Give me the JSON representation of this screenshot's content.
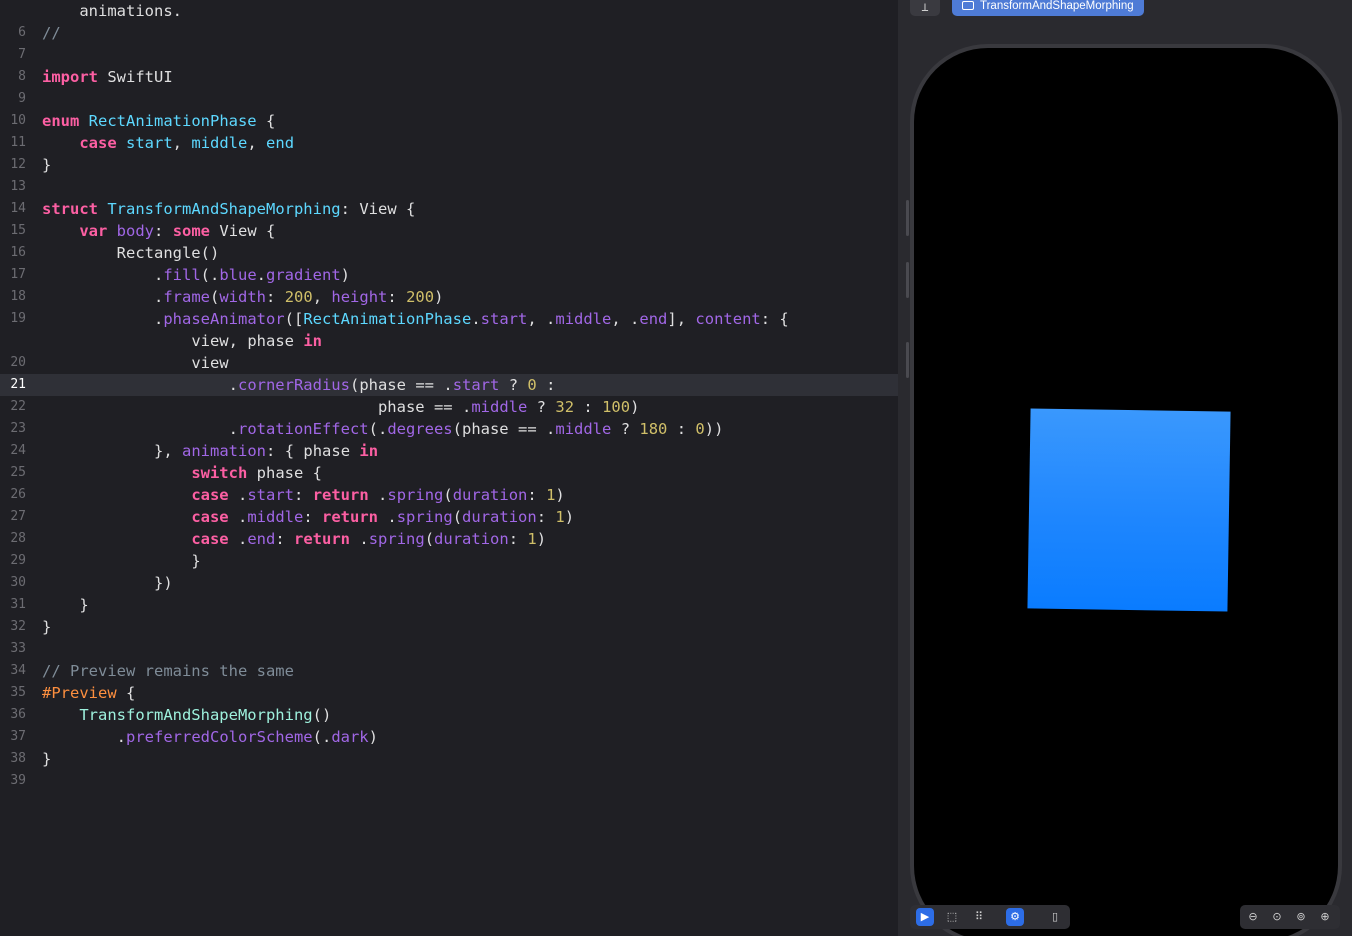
{
  "editor": {
    "current_line": "21",
    "lines": [
      {
        "n": "",
        "code": "    animations."
      },
      {
        "n": "6",
        "code": "//"
      },
      {
        "n": "7",
        "code": ""
      },
      {
        "n": "8",
        "code": "import SwiftUI"
      },
      {
        "n": "9",
        "code": ""
      },
      {
        "n": "10",
        "code": "enum RectAnimationPhase {"
      },
      {
        "n": "11",
        "code": "    case start, middle, end"
      },
      {
        "n": "12",
        "code": "}"
      },
      {
        "n": "13",
        "code": ""
      },
      {
        "n": "14",
        "code": "struct TransformAndShapeMorphing: View {"
      },
      {
        "n": "15",
        "code": "    var body: some View {"
      },
      {
        "n": "16",
        "code": "        Rectangle()"
      },
      {
        "n": "17",
        "code": "            .fill(.blue.gradient)"
      },
      {
        "n": "18",
        "code": "            .frame(width: 200, height: 200)"
      },
      {
        "n": "19",
        "code": "            .phaseAnimator([RectAnimationPhase.start, .middle, .end], content: {"
      },
      {
        "n": "",
        "code": "                view, phase in"
      },
      {
        "n": "20",
        "code": "                view"
      },
      {
        "n": "21",
        "code": "                    .cornerRadius(phase == .start ? 0 :"
      },
      {
        "n": "22",
        "code": "                                    phase == .middle ? 32 : 100)"
      },
      {
        "n": "23",
        "code": "                    .rotationEffect(.degrees(phase == .middle ? 180 : 0))"
      },
      {
        "n": "24",
        "code": "            }, animation: { phase in"
      },
      {
        "n": "25",
        "code": "                switch phase {"
      },
      {
        "n": "26",
        "code": "                case .start: return .spring(duration: 1)"
      },
      {
        "n": "27",
        "code": "                case .middle: return .spring(duration: 1)"
      },
      {
        "n": "28",
        "code": "                case .end: return .spring(duration: 1)"
      },
      {
        "n": "29",
        "code": "                }"
      },
      {
        "n": "30",
        "code": "            })"
      },
      {
        "n": "31",
        "code": "    }"
      },
      {
        "n": "32",
        "code": "}"
      },
      {
        "n": "33",
        "code": ""
      },
      {
        "n": "34",
        "code": "// Preview remains the same"
      },
      {
        "n": "35",
        "code": "#Preview {"
      },
      {
        "n": "36",
        "code": "    TransformAndShapeMorphing()"
      },
      {
        "n": "37",
        "code": "        .preferredColorScheme(.dark)"
      },
      {
        "n": "38",
        "code": "}"
      },
      {
        "n": "39",
        "code": ""
      }
    ]
  },
  "preview": {
    "tab_label": "TransformAndShapeMorphing",
    "pin_icon": "pin-icon",
    "tab_icon": "preview-window-icon",
    "rendered_shape_color": "#1e86fe",
    "bottom_left_controls": [
      {
        "name": "live-mode-button",
        "icon": "play-circle-icon",
        "glyph": "▶",
        "active": true
      },
      {
        "name": "selectable-mode-button",
        "icon": "cursor-select-icon",
        "glyph": "⬚",
        "active": false
      },
      {
        "name": "variants-button",
        "icon": "grid-icon",
        "glyph": "⠿",
        "active": false
      },
      {
        "name": "device-settings-button",
        "icon": "toggle-settings-icon",
        "glyph": "⚙",
        "active": true
      },
      {
        "name": "device-button",
        "icon": "iphone-icon",
        "glyph": "▯",
        "active": false
      }
    ],
    "zoom_controls": [
      {
        "name": "zoom-out-button",
        "icon": "zoom-out-icon",
        "glyph": "⊖"
      },
      {
        "name": "zoom-fit-button",
        "icon": "zoom-fit-icon",
        "glyph": "⊙"
      },
      {
        "name": "zoom-actual-button",
        "icon": "zoom-actual-icon",
        "glyph": "⊚"
      },
      {
        "name": "zoom-in-button",
        "icon": "zoom-in-icon",
        "glyph": "⊕"
      }
    ]
  }
}
